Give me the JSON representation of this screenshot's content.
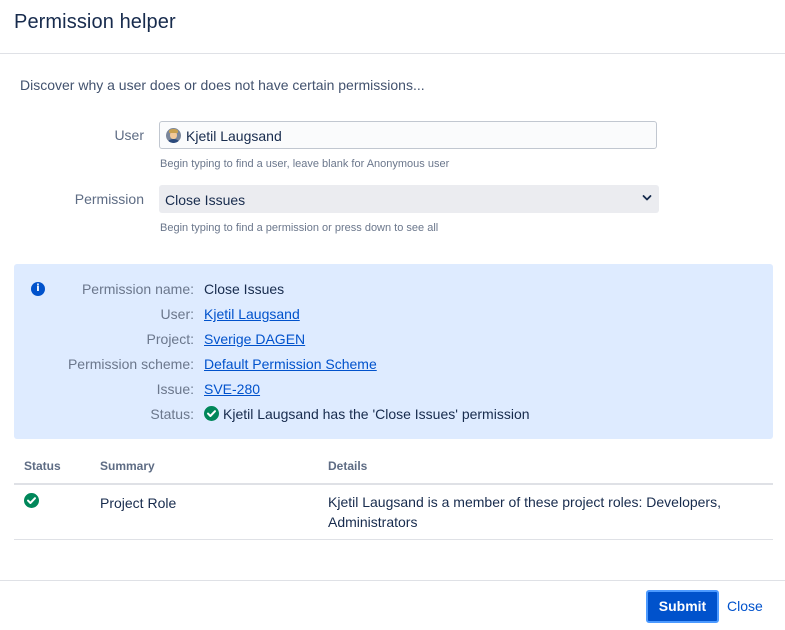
{
  "dialog": {
    "title": "Permission helper",
    "intro": "Discover why a user does or does not have certain permissions..."
  },
  "form": {
    "user_label": "User",
    "user_value": "Kjetil Laugsand",
    "user_help": "Begin typing to find a user, leave blank for Anonymous user",
    "permission_label": "Permission",
    "permission_value": "Close Issues",
    "permission_help": "Begin typing to find a permission or press down to see all"
  },
  "info": {
    "rows": [
      {
        "label": "Permission name:",
        "value": "Close Issues"
      },
      {
        "label": "User:",
        "value": "Kjetil Laugsand"
      },
      {
        "label": "Project:",
        "value": "Sverige DAGEN"
      },
      {
        "label": "Permission scheme:",
        "value": "Default Permission Scheme"
      },
      {
        "label": "Issue:",
        "value": "SVE-280"
      },
      {
        "label": "Status:",
        "value": "Kjetil Laugsand has the 'Close Issues' permission"
      }
    ]
  },
  "table": {
    "headers": [
      "Status",
      "Summary",
      "Details"
    ],
    "rows": [
      {
        "summary": "Project Role",
        "details_line1": "Kjetil Laugsand is a member of these project roles: Developers,",
        "details_line2": "Administrators"
      }
    ]
  },
  "footer": {
    "submit_label": "Submit",
    "close_label": "Close"
  },
  "colors": {
    "accent": "#0052cc",
    "success": "#00875a",
    "info_background": "#deebff"
  }
}
